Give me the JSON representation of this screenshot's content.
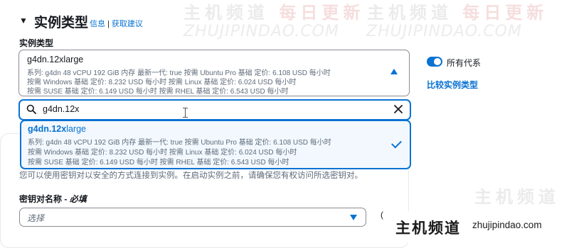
{
  "header": {
    "title": "实例类型",
    "link_info": "信息",
    "link_sep": "|",
    "link_advice": "获取建议"
  },
  "instance_type": {
    "label": "实例类型",
    "selected": {
      "name": "g4dn.12xlarge",
      "spec_line1": "系列: g4dn    48 vCPU    192 GiB 内存    最新一代: true    按需 Ubuntu Pro 基础 定价: 6.108 USD 每小时",
      "spec_line2": "按需 Windows 基础 定价: 8.232 USD 每小时    按需 Linux 基础 定价: 6.024 USD 每小时",
      "spec_line3": "按需 SUSE 基础 定价: 6.149 USD 每小时    按需 RHEL 基础 定价: 6.543 USD 每小时"
    },
    "all_generations_label": "所有代系",
    "all_generations_on": true,
    "compare_link": "比较实例类型",
    "search_value": "g4dn.12x",
    "option": {
      "name_match": "g4dn.12x",
      "name_rest": "large",
      "spec_line1": "系列: g4dn    48 vCPU    192 GiB 内存    最新一代: true    按需 Ubuntu Pro 基础 定价: 6.108 USD 每小时",
      "spec_line2": "按需 Windows 基础 定价: 8.232 USD 每小时    按需 Linux 基础 定价: 6.024 USD 每小时",
      "spec_line3": "按需 SUSE 基础 定价: 6.149 USD 每小时    按需 RHEL 基础 定价: 6.543 USD 每小时"
    }
  },
  "key_pair": {
    "description": "您可以使用密钥对以安全的方式连接到实例。在启动实例之前，请确保您有权访问所选密钥对。",
    "label": "密钥对名称",
    "required": "必填",
    "placeholder": "选择",
    "right_hint": "("
  },
  "watermark": {
    "cn_a": "主机频道",
    "cn_b": "每日更新",
    "en": "ZHUJIPINDAO.COM"
  },
  "brand": {
    "cn": "主机频道",
    "url": "zhujipindao.com"
  },
  "colors": {
    "accent": "#0972d3",
    "text": "#16191f",
    "muted": "#5f6b7a",
    "selected_bg": "#f2f8fd"
  },
  "icons": [
    "expand-arrow-icon",
    "search-icon",
    "clear-icon",
    "check-icon",
    "caret-up-icon",
    "caret-down-icon",
    "text-cursor-icon"
  ]
}
